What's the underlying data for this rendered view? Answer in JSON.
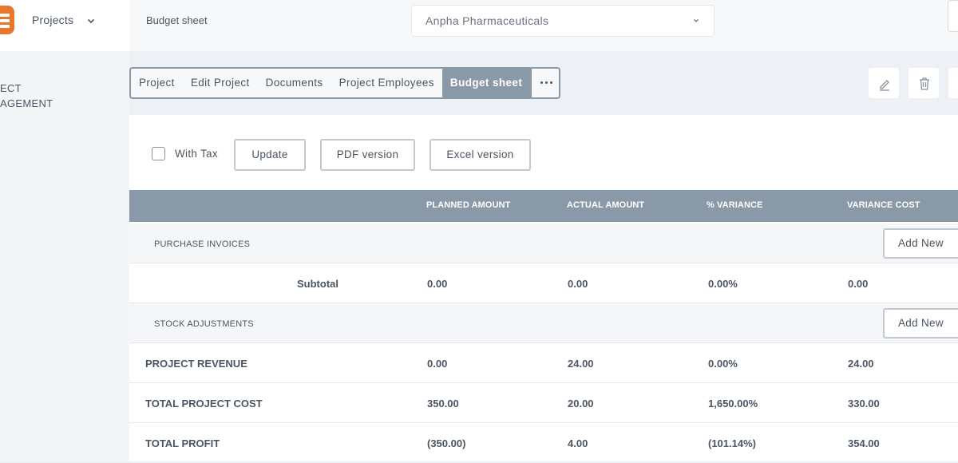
{
  "sidebar": {
    "menu_label": "Projects",
    "section_line1": "ECT",
    "section_line2": "AGEMENT"
  },
  "topbar": {
    "breadcrumb": "Budget sheet",
    "company": "Anpha Pharmaceuticals"
  },
  "tabs": [
    {
      "label": "Project"
    },
    {
      "label": "Edit Project"
    },
    {
      "label": "Documents"
    },
    {
      "label": "Project Employees"
    },
    {
      "label": "Budget sheet",
      "active": true
    }
  ],
  "toolbar": {
    "with_tax_label": "With Tax",
    "with_tax_checked": false,
    "update": "Update",
    "pdf": "PDF version",
    "excel": "Excel version"
  },
  "table": {
    "headers": [
      "PLANNED AMOUNT",
      "ACTUAL AMOUNT",
      "% VARIANCE",
      "VARIANCE COST"
    ],
    "add_new": "Add New",
    "purchase_invoices": "PURCHASE INVOICES",
    "subtotal": {
      "label": "Subtotal",
      "planned": "0.00",
      "actual": "0.00",
      "variance_pct": "0.00%",
      "variance_cost": "0.00"
    },
    "stock_adjustments": "STOCK ADJUSTMENTS",
    "revenue": {
      "label": "PROJECT REVENUE",
      "planned": "0.00",
      "actual": "24.00",
      "variance_pct": "0.00%",
      "variance_cost": "24.00"
    },
    "cost": {
      "label": "TOTAL PROJECT COST",
      "planned": "350.00",
      "actual": "20.00",
      "variance_pct": "1,650.00%",
      "variance_cost": "330.00"
    },
    "profit": {
      "label": "TOTAL PROFIT",
      "planned": "(350.00)",
      "actual": "4.00",
      "variance_pct": "(101.14%)",
      "variance_cost": "354.00"
    }
  },
  "colors": {
    "accent": "#8a99a8",
    "logo": "#e8762c"
  }
}
